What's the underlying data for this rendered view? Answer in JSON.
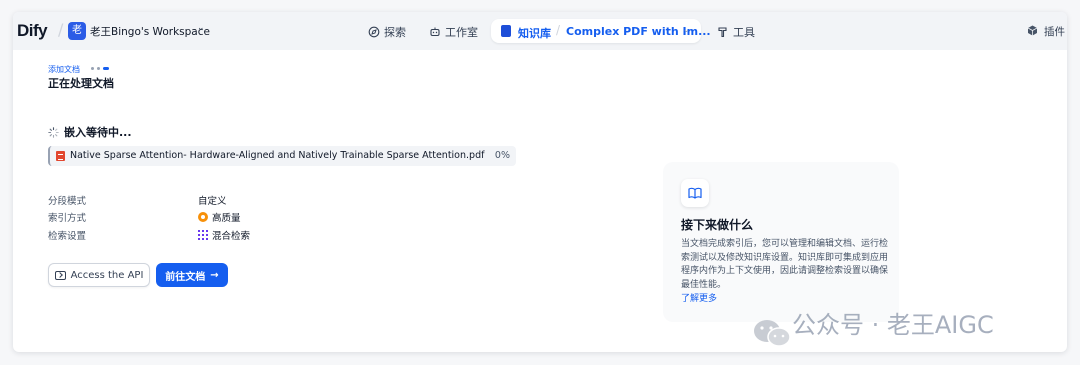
{
  "header": {
    "logo": "Dify",
    "workspace": {
      "avatar": "老",
      "name": "老王Bingo's Workspace"
    },
    "nav": [
      {
        "label": "探索",
        "icon": "compass-icon"
      },
      {
        "label": "工作室",
        "icon": "robot-icon"
      }
    ],
    "knowledge": {
      "label": "知识库",
      "dataset": "Complex PDF with Im..."
    },
    "tools": {
      "label": "工具",
      "icon": "hammer-icon"
    },
    "plugins": {
      "label": "插件",
      "icon": "cube-icon"
    }
  },
  "steps": {
    "breadcrumb": "添加文档",
    "title": "正在处理文档"
  },
  "embedding": {
    "status": "嵌入等待中...",
    "file_name": "Native Sparse Attention- Hardware-Aligned and Natively Trainable Sparse Attention.pdf",
    "progress": "0%"
  },
  "settings": [
    {
      "key": "分段模式",
      "value": "自定义",
      "icon": ""
    },
    {
      "key": "索引方式",
      "value": "高质量",
      "icon": "high-quality-icon"
    },
    {
      "key": "检索设置",
      "value": "混合检索",
      "icon": "hybrid-search-icon"
    }
  ],
  "actions": {
    "api": "Access the API",
    "go": "前往文档"
  },
  "next": {
    "title": "接下来做什么",
    "body": "当文档完成索引后，您可以管理和编辑文档、运行检索测试以及修改知识库设置。知识库即可集成到应用程序内作为上下文使用，因此请调整检索设置以确保最佳性能。",
    "link": "了解更多"
  },
  "watermark": "公众号 · 老王AIGC",
  "colors": {
    "accent": "#155eef",
    "pdf": "#e2472f",
    "quality": "#f79009",
    "hybrid": "#6938ef"
  }
}
